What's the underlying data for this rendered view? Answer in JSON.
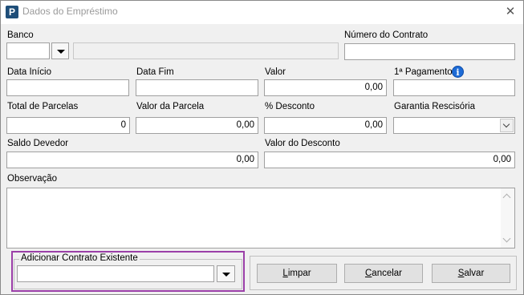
{
  "window": {
    "app_icon_letter": "P",
    "title": "Dados do Empréstimo",
    "close_glyph": "✕"
  },
  "fields": {
    "banco": {
      "label": "Banco",
      "code": "",
      "name": ""
    },
    "numero_contrato": {
      "label": "Número do Contrato",
      "value": ""
    },
    "data_inicio": {
      "label": "Data Início",
      "value": ""
    },
    "data_fim": {
      "label": "Data Fim",
      "value": ""
    },
    "valor": {
      "label": "Valor",
      "value": "0,00"
    },
    "primeiro_pagamento": {
      "label": "1ª Pagamento",
      "value": ""
    },
    "total_parcelas": {
      "label": "Total de Parcelas",
      "value": "0"
    },
    "valor_parcela": {
      "label": "Valor da Parcela",
      "value": "0,00"
    },
    "desconto_pct": {
      "label": "% Desconto",
      "value": "0,00"
    },
    "garantia_rescisoria": {
      "label": "Garantia Rescisória",
      "value": ""
    },
    "saldo_devedor": {
      "label": "Saldo Devedor",
      "value": "0,00"
    },
    "valor_desconto": {
      "label": "Valor do Desconto",
      "value": "0,00"
    },
    "observacao": {
      "label": "Observação",
      "value": ""
    }
  },
  "adicionar_contrato": {
    "legend": "Adicionar Contrato Existente",
    "value": ""
  },
  "buttons": {
    "limpar": {
      "first": "L",
      "rest": "impar"
    },
    "cancelar": {
      "first": "C",
      "rest": "ancelar"
    },
    "salvar": {
      "first": "S",
      "rest": "alvar"
    }
  },
  "icons": {
    "info": "i"
  },
  "colors": {
    "highlight": "#9b3fa8",
    "info_blue": "#1d6bd6",
    "app_icon": "#1f4e79"
  }
}
